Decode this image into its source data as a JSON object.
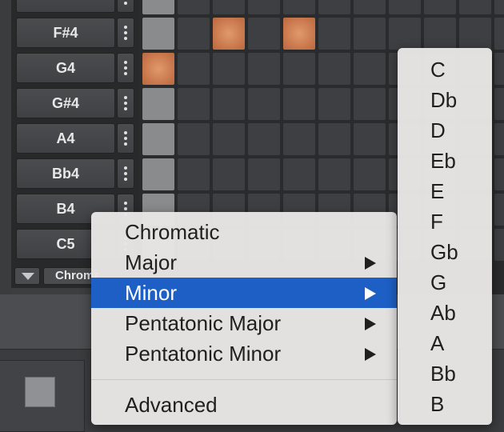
{
  "rows": [
    {
      "label": ""
    },
    {
      "label": "F#4"
    },
    {
      "label": "G4"
    },
    {
      "label": "G#4"
    },
    {
      "label": "A4"
    },
    {
      "label": "Bb4"
    },
    {
      "label": "B4"
    },
    {
      "label": "C5"
    }
  ],
  "active_cells": [
    [
      1,
      2
    ],
    [
      1,
      4
    ],
    [
      2,
      0
    ]
  ],
  "scale_select": {
    "value": "Chromatic"
  },
  "menu": {
    "items": [
      {
        "label": "Chromatic",
        "has_submenu": false,
        "selected": false
      },
      {
        "label": "Major",
        "has_submenu": true,
        "selected": false
      },
      {
        "label": "Minor",
        "has_submenu": true,
        "selected": true
      },
      {
        "label": "Pentatonic Major",
        "has_submenu": true,
        "selected": false
      },
      {
        "label": "Pentatonic Minor",
        "has_submenu": true,
        "selected": false
      }
    ],
    "advanced_label": "Advanced"
  },
  "submenu": {
    "items": [
      "C",
      "Db",
      "D",
      "Eb",
      "E",
      "F",
      "Gb",
      "G",
      "Ab",
      "A",
      "Bb",
      "B"
    ]
  },
  "colors": {
    "step_on": "#c7754a",
    "selection": "#1d5fc4"
  },
  "icons": {
    "row_menu": "vertical-ellipsis-icon",
    "scale_arrow": "triangle-down-icon",
    "submenu_arrow": "triangle-right-icon",
    "stop": "stop-square-icon"
  }
}
